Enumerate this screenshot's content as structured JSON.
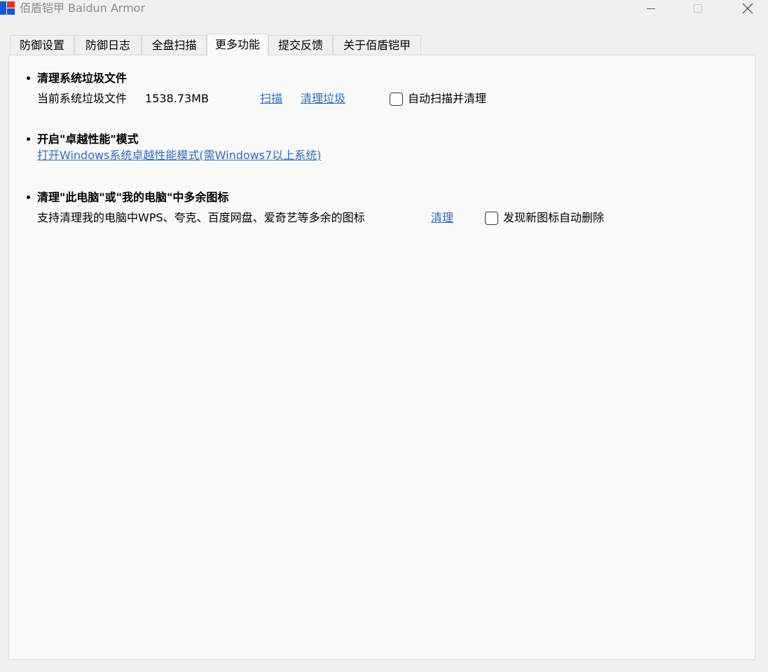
{
  "window": {
    "title": "佰盾铠甲 Baidun Armor",
    "logo_icon": "baidun-logo-icon",
    "controls": [
      "minimize-icon",
      "maximize-icon",
      "close-icon"
    ]
  },
  "tabs": [
    {
      "label": "防御设置",
      "active": false
    },
    {
      "label": "防御日志",
      "active": false
    },
    {
      "label": "全盘扫描",
      "active": false
    },
    {
      "label": "更多功能",
      "active": true
    },
    {
      "label": "提交反馈",
      "active": false
    },
    {
      "label": "关于佰盾铠甲",
      "active": false
    }
  ],
  "sections": {
    "junk": {
      "heading": "清理系统垃圾文件",
      "desc": "当前系统垃圾文件",
      "size": "1538.73MB",
      "scan_link": "扫描",
      "clean_link": "清理垃圾",
      "auto_label": "自动扫描并清理",
      "auto_checked": false
    },
    "performance": {
      "heading": "开启\"卓越性能\"模式",
      "link": "打开Windows系统卓越性能模式(需Windows7以上系统)"
    },
    "icons": {
      "heading": "清理\"此电脑\"或\"我的电脑\"中多余图标",
      "desc": "支持清理我的电脑中WPS、夸克、百度网盘、爱奇艺等多余的图标",
      "clean_link": "清理",
      "auto_label": "发现新图标自动删除",
      "auto_checked": false
    }
  },
  "colors": {
    "link": "#2b6cc4",
    "logo_blue": "#1a55d6",
    "logo_red": "#e8331c"
  }
}
